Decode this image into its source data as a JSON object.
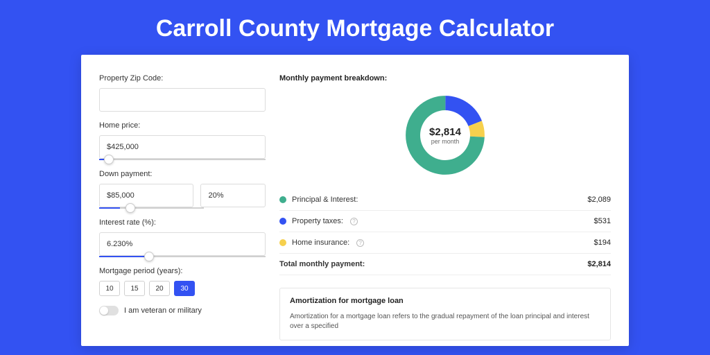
{
  "header": {
    "title": "Carroll County Mortgage Calculator"
  },
  "form": {
    "zip": {
      "label": "Property Zip Code:",
      "value": ""
    },
    "price": {
      "label": "Home price:",
      "value": "$425,000",
      "slider_pct": 6
    },
    "down": {
      "label": "Down payment:",
      "value": "$85,000",
      "pct": "20%",
      "slider_pct": 20
    },
    "rate": {
      "label": "Interest rate (%):",
      "value": "6.230%",
      "slider_pct": 30
    },
    "period": {
      "label": "Mortgage period (years):",
      "options": [
        "10",
        "15",
        "20",
        "30"
      ],
      "selected": "30"
    },
    "veteran": {
      "label": "I am veteran or military",
      "on": false
    }
  },
  "breakdown": {
    "title": "Monthly payment breakdown:",
    "center_value": "$2,814",
    "center_sub": "per month",
    "items": [
      {
        "label": "Principal & Interest:",
        "value": "$2,089",
        "color": "green",
        "info": false
      },
      {
        "label": "Property taxes:",
        "value": "$531",
        "color": "blue",
        "info": true
      },
      {
        "label": "Home insurance:",
        "value": "$194",
        "color": "yellow",
        "info": true
      }
    ],
    "total_label": "Total monthly payment:",
    "total_value": "$2,814"
  },
  "chart_data": {
    "type": "pie",
    "title": "Monthly payment breakdown:",
    "series": [
      {
        "name": "Principal & Interest",
        "value": 2089,
        "color": "#3fae8e"
      },
      {
        "name": "Property taxes",
        "value": 531,
        "color": "#3352f2"
      },
      {
        "name": "Home insurance",
        "value": 194,
        "color": "#f6d04d"
      }
    ],
    "total": 2814,
    "unit": "USD per month"
  },
  "amort": {
    "title": "Amortization for mortgage loan",
    "text": "Amortization for a mortgage loan refers to the gradual repayment of the loan principal and interest over a specified"
  }
}
